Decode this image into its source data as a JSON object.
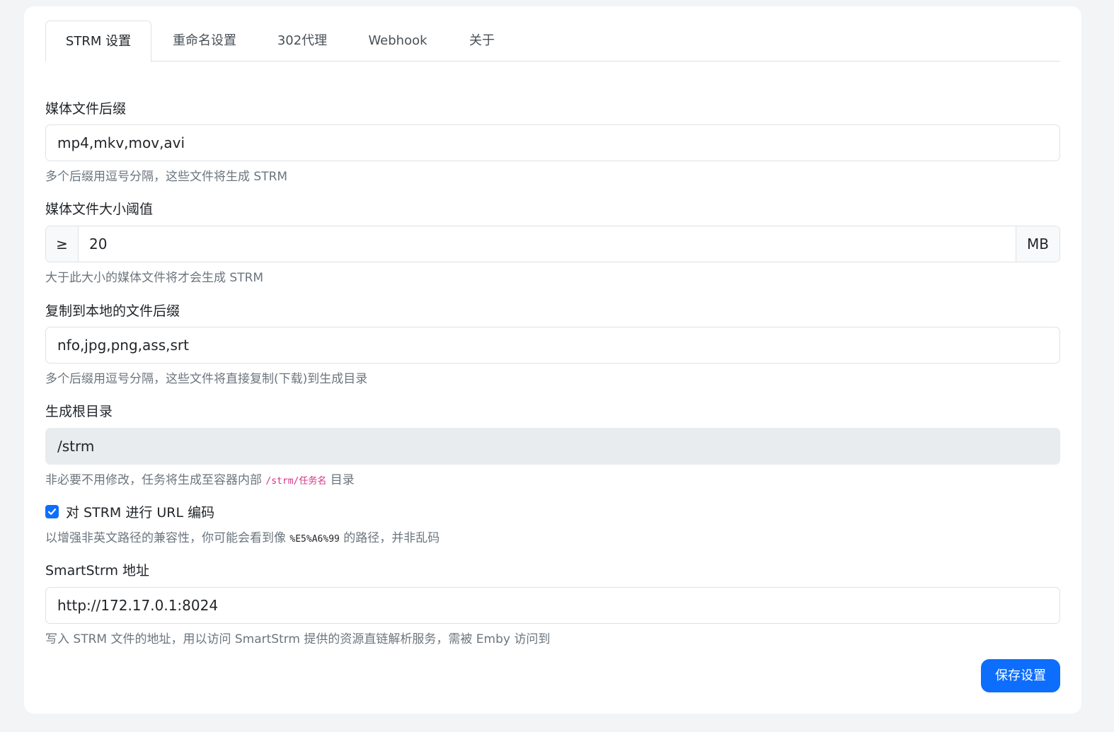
{
  "tabs": [
    {
      "label": "STRM 设置",
      "active": true
    },
    {
      "label": "重命名设置",
      "active": false
    },
    {
      "label": "302代理",
      "active": false
    },
    {
      "label": "Webhook",
      "active": false
    },
    {
      "label": "关于",
      "active": false
    }
  ],
  "media_ext": {
    "label": "媒体文件后缀",
    "value": "mp4,mkv,mov,avi",
    "help": "多个后缀用逗号分隔，这些文件将生成 STRM"
  },
  "size_threshold": {
    "label": "媒体文件大小阈值",
    "prefix": "≥",
    "value": "20",
    "unit": "MB",
    "help": "大于此大小的媒体文件将才会生成 STRM"
  },
  "copy_ext": {
    "label": "复制到本地的文件后缀",
    "value": "nfo,jpg,png,ass,srt",
    "help": "多个后缀用逗号分隔，这些文件将直接复制(下载)到生成目录"
  },
  "root_dir": {
    "label": "生成根目录",
    "value": "/strm",
    "help_before": "非必要不用修改，任务将生成至容器内部",
    "help_code": "/strm/任务名",
    "help_after": "目录"
  },
  "url_encode": {
    "checked": true,
    "label": "对 STRM 进行 URL 编码",
    "help_before": "以增强非英文路径的兼容性，你可能会看到像",
    "help_code": "%E5%A6%99",
    "help_after": "的路径，并非乱码"
  },
  "smartstrm": {
    "label": "SmartStrm 地址",
    "value": "http://172.17.0.1:8024",
    "help": "写入 STRM 文件的地址，用以访问 SmartStrm 提供的资源直链解析服务，需被 Emby 访问到"
  },
  "save_label": "保存设置",
  "colors": {
    "primary": "#0d6efd",
    "code": "#d63384",
    "muted": "#6c757d",
    "disabled_bg": "#e9ecef"
  },
  "icons": {
    "checkbox": "check-icon"
  }
}
